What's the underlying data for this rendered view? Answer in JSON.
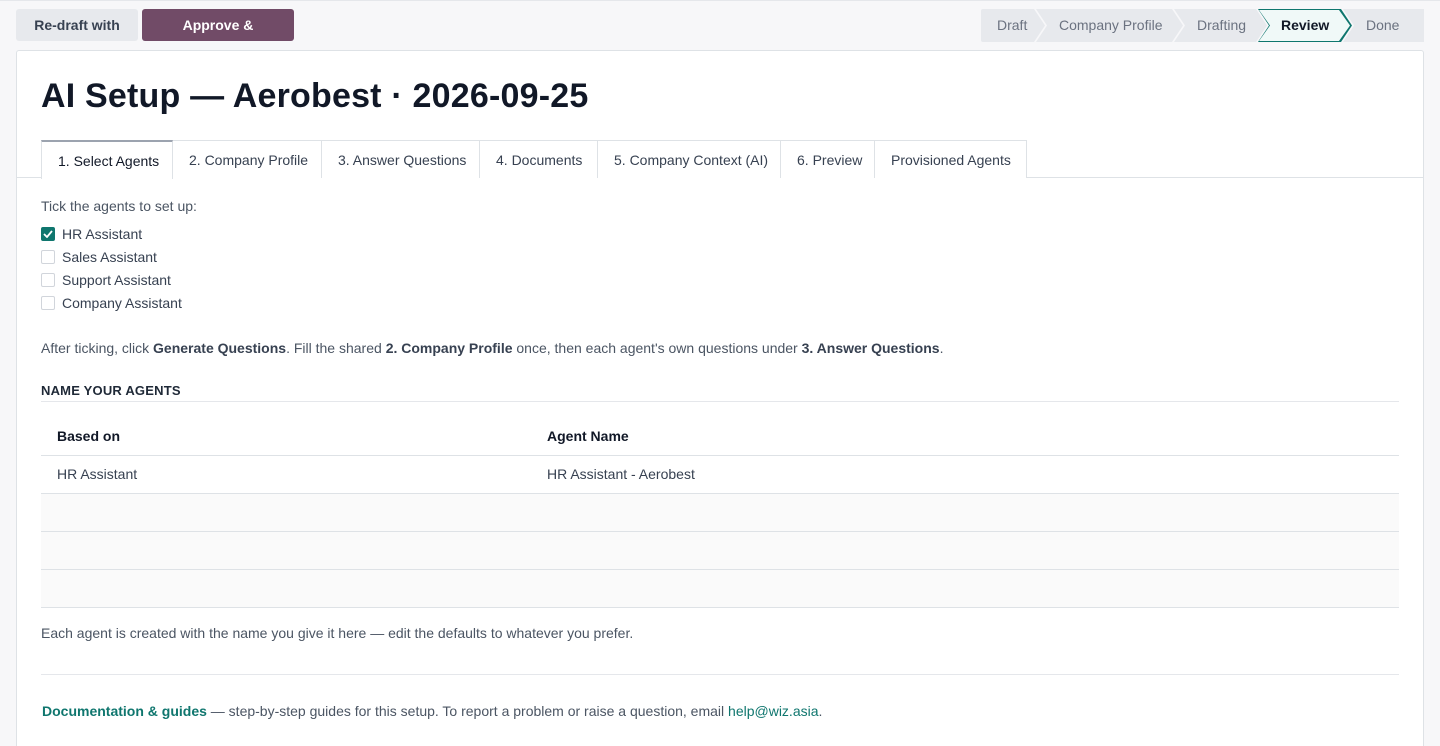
{
  "toolbar": {
    "redraft_label": "Re-draft with AI",
    "approve_label": "Approve & Provision"
  },
  "status_stages": [
    {
      "label": "Draft",
      "active": false
    },
    {
      "label": "Company Profile",
      "active": false
    },
    {
      "label": "Drafting",
      "active": false
    },
    {
      "label": "Review",
      "active": true
    },
    {
      "label": "Done",
      "active": false
    }
  ],
  "page": {
    "title": "AI Setup — Aerobest · 2026-09-25"
  },
  "tabs": [
    {
      "label": "1. Select Agents",
      "active": true
    },
    {
      "label": "2. Company Profile",
      "active": false
    },
    {
      "label": "3. Answer Questions",
      "active": false
    },
    {
      "label": "4. Documents",
      "active": false
    },
    {
      "label": "5. Company Context (AI)",
      "active": false
    },
    {
      "label": "6. Preview",
      "active": false
    },
    {
      "label": "Provisioned Agents",
      "active": false
    }
  ],
  "select_agents": {
    "hint": "Tick the agents to set up:",
    "agents": [
      {
        "label": "HR Assistant",
        "checked": true
      },
      {
        "label": "Sales Assistant",
        "checked": false
      },
      {
        "label": "Support Assistant",
        "checked": false
      },
      {
        "label": "Company Assistant",
        "checked": false
      }
    ],
    "instructions": {
      "part1": "After ticking, click ",
      "bold1": "Generate Questions",
      "part2": ". Fill the shared ",
      "bold2": "2. Company Profile",
      "part3": " once, then each agent's own questions under ",
      "bold3": "3. Answer Questions",
      "part4": "."
    }
  },
  "name_agents": {
    "heading": "NAME YOUR AGENTS",
    "columns": [
      "Based on",
      "Agent Name"
    ],
    "rows": [
      {
        "based_on": "HR Assistant",
        "agent_name": "HR Assistant - Aerobest"
      }
    ],
    "note": "Each agent is created with the name you give it here — edit the defaults to whatever you prefer."
  },
  "footer": {
    "doc_link": "Documentation & guides",
    "text": " — step-by-step guides for this setup. To report a problem or raise a question, email ",
    "email": "help@wiz.asia",
    "end": "."
  },
  "colors": {
    "primary": "#714b67",
    "accent": "#0f766e"
  }
}
